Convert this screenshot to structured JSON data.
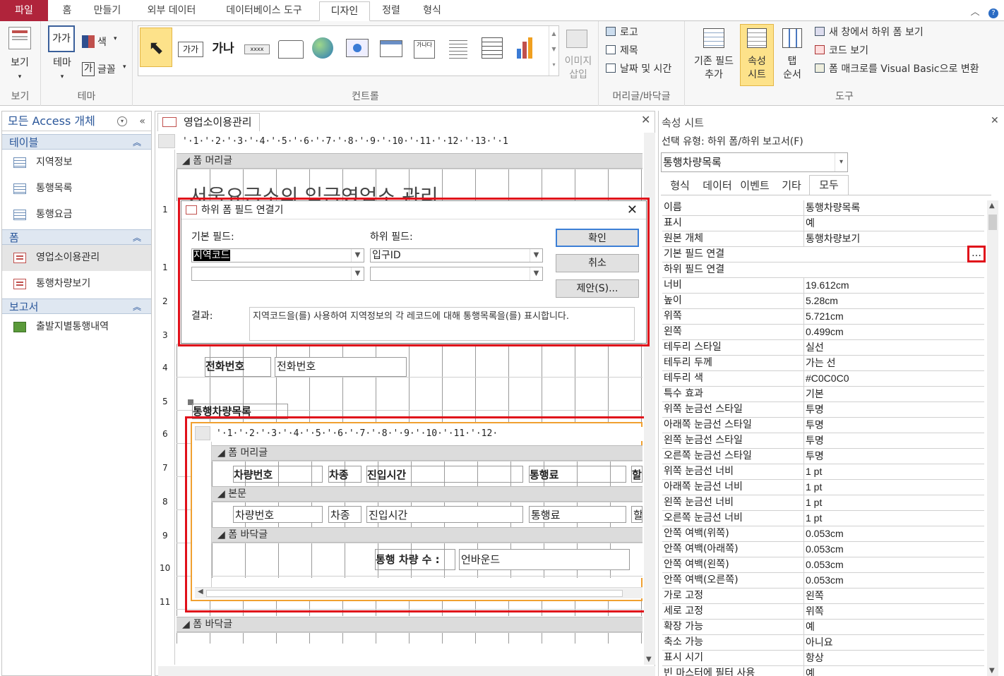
{
  "ribbon": {
    "tabs": [
      "파일",
      "홈",
      "만들기",
      "외부 데이터",
      "데이터베이스 도구",
      "디자인",
      "정렬",
      "형식"
    ],
    "groups": {
      "views": {
        "label": "보기",
        "button": "보기"
      },
      "themes": {
        "label": "테마",
        "theme_button": "테마",
        "colors": "색",
        "fonts": "글꼴",
        "theme_icon_text": "가가"
      },
      "controls": {
        "label": "컨트롤",
        "image_insert": "이미지\n삽입",
        "label_text": "가나",
        "text_box": "가가"
      },
      "header_footer": {
        "label": "머리글/바닥글",
        "logo": "로고",
        "title": "제목",
        "datetime": "날짜 및 시간"
      },
      "tools": {
        "label": "도구",
        "add_existing": "기존 필드\n추가",
        "property_sheet": "속성\n시트",
        "tab_order": "탭\n순서",
        "subform_new_window": "새 창에서 하위 폼 보기",
        "view_code": "코드 보기",
        "convert_macros": "폼 매크로를 Visual Basic으로 변환"
      }
    }
  },
  "nav": {
    "title": "모든 Access 개체",
    "sections": [
      {
        "label": "테이블",
        "items": [
          "지역정보",
          "통행목록",
          "통행요금"
        ]
      },
      {
        "label": "폼",
        "items": [
          "영업소이용관리",
          "통행차량보기"
        ]
      },
      {
        "label": "보고서",
        "items": [
          "출발지별통행내역"
        ]
      }
    ]
  },
  "document": {
    "tab": "영업소이용관리",
    "ruler": "'·1·'·2·'·3·'·4·'·5·'·6·'·7·'·8·'·9·'·10·'·11·'·12·'·13·'·1",
    "sections": {
      "header": "폼 머리글",
      "footer": "폼 바닥글"
    },
    "header_title": "서울요금소의 입금영업소 관리",
    "phone_label": "전화번호",
    "phone_field": "전화번호",
    "subform_label": "통행차량목록",
    "vruler": [
      "1",
      "1",
      "2",
      "3",
      "4",
      "5",
      "6",
      "7",
      "8",
      "9",
      "10",
      "11"
    ],
    "subform": {
      "ruler": "'·1·'·2·'·3·'·4·'·5·'·6·'·7·'·8·'·9·'·10·'·11·'·12·",
      "sections": {
        "header": "폼 머리글",
        "detail": "본문",
        "footer": "폼 바닥글"
      },
      "header_labels": [
        "차량번호",
        "차종",
        "진입시간",
        "통행료",
        "할"
      ],
      "fields": [
        "차량번호",
        "차종",
        "진입시간",
        "통행료",
        "할"
      ],
      "footer_label": "통행 차량 수 :",
      "footer_field": "언바운드"
    }
  },
  "dialog": {
    "title": "하위 폼 필드 연결기",
    "master_label": "기본 필드:",
    "child_label": "하위 필드:",
    "master_value": "지역코드",
    "child_value": "입구ID",
    "ok": "확인",
    "cancel": "취소",
    "suggest": "제안(S)...",
    "result_label": "결과:",
    "result_text": "지역코드을(를) 사용하여 지역정보의 각 레코드에 대해 통행목록을(를) 표시합니다."
  },
  "property_sheet": {
    "title": "속성 시트",
    "selection_type": "선택 유형: 하위 폼/하위 보고서(F)",
    "selected_object": "통행차량목록",
    "tabs": [
      "형식",
      "데이터",
      "이벤트",
      "기타",
      "모두"
    ],
    "active_tab": "모두",
    "builder_button": "…",
    "rows": [
      [
        "이름",
        "통행차량목록"
      ],
      [
        "표시",
        "예"
      ],
      [
        "원본 개체",
        "통행차량보기"
      ],
      [
        "기본 필드 연결",
        ""
      ],
      [
        "하위 필드 연결",
        ""
      ],
      [
        "너비",
        "19.612cm"
      ],
      [
        "높이",
        "5.28cm"
      ],
      [
        "위쪽",
        "5.721cm"
      ],
      [
        "왼쪽",
        "0.499cm"
      ],
      [
        "테두리 스타일",
        "실선"
      ],
      [
        "테두리 두께",
        "가는 선"
      ],
      [
        "테두리 색",
        "#C0C0C0"
      ],
      [
        "특수 효과",
        "기본"
      ],
      [
        "위쪽 눈금선 스타일",
        "투명"
      ],
      [
        "아래쪽 눈금선 스타일",
        "투명"
      ],
      [
        "왼쪽 눈금선 스타일",
        "투명"
      ],
      [
        "오른쪽 눈금선 스타일",
        "투명"
      ],
      [
        "위쪽 눈금선 너비",
        "1 pt"
      ],
      [
        "아래쪽 눈금선 너비",
        "1 pt"
      ],
      [
        "왼쪽 눈금선 너비",
        "1 pt"
      ],
      [
        "오른쪽 눈금선 너비",
        "1 pt"
      ],
      [
        "안쪽 여백(위쪽)",
        "0.053cm"
      ],
      [
        "안쪽 여백(아래쪽)",
        "0.053cm"
      ],
      [
        "안쪽 여백(왼쪽)",
        "0.053cm"
      ],
      [
        "안쪽 여백(오른쪽)",
        "0.053cm"
      ],
      [
        "가로 고정",
        "왼쪽"
      ],
      [
        "세로 고정",
        "위쪽"
      ],
      [
        "확장 가능",
        "예"
      ],
      [
        "축소 가능",
        "아니요"
      ],
      [
        "표시 시기",
        "항상"
      ],
      [
        "빈 마스터에 필터 사용",
        "예"
      ]
    ]
  },
  "colors": {
    "file_tab": "#b0243b",
    "highlight": "#e0101a",
    "accent": "#2b579a"
  }
}
